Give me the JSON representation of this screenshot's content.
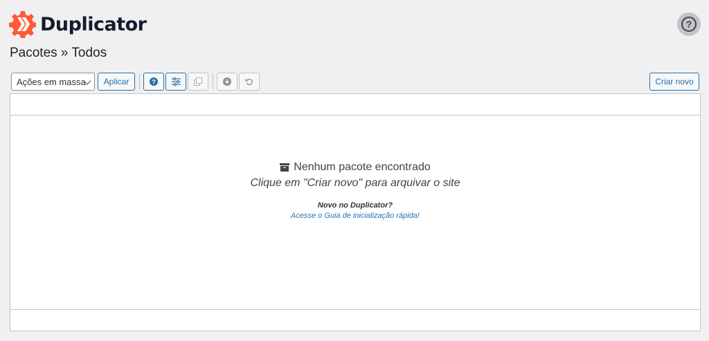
{
  "brand": {
    "name": "Duplicator",
    "accent": "#ff5a36",
    "text_color": "#141c2c"
  },
  "help": {
    "icon": "help-circle-icon",
    "label": "?"
  },
  "page": {
    "title": "Pacotes » Todos"
  },
  "toolbar": {
    "bulk_select": {
      "value": "Ações em massa",
      "icon": "chevron-down-icon"
    },
    "apply_label": "Aplicar",
    "icons": [
      "help-filled-icon",
      "sliders-icon",
      "copy-icon",
      "download-icon",
      "undo-icon"
    ],
    "create_label": "Criar novo"
  },
  "empty_state": {
    "icon": "archive-icon",
    "title": "Nenhum pacote encontrado",
    "subtitle": "Clique em \"Criar novo\" para arquivar o site",
    "new_label": "Novo no Duplicator?",
    "guide_link": "Acesse o Guia de inicialização rápida!"
  },
  "colors": {
    "primary": "#2271b1",
    "border": "#c3c4c7",
    "background": "#f0f0f1"
  }
}
